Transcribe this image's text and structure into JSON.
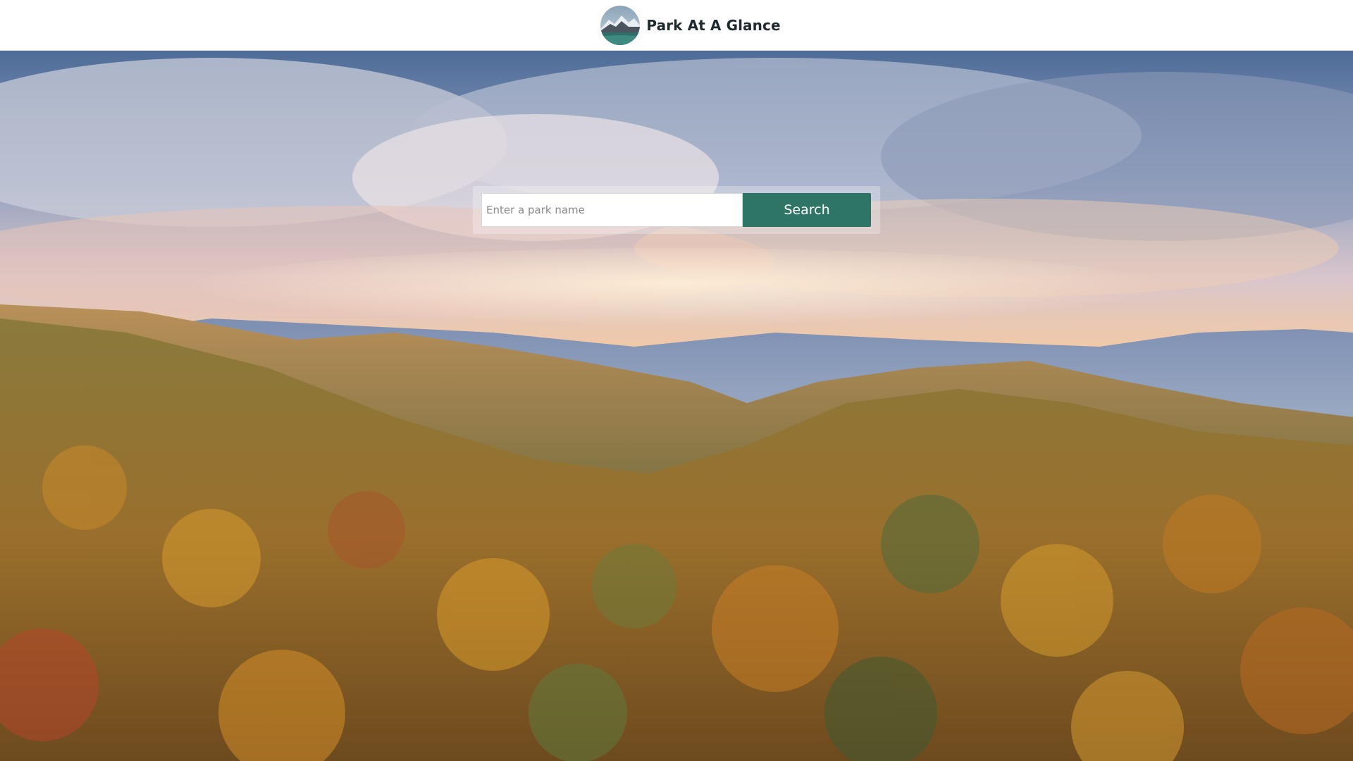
{
  "header": {
    "title": "Park At A Glance",
    "logo_icon": "mountain-lake-logo"
  },
  "search": {
    "placeholder": "Enter a park name",
    "value": "",
    "button_label": "Search",
    "button_color": "#2f7566"
  },
  "hero": {
    "image": "autumn-forest-mountains-landscape"
  }
}
